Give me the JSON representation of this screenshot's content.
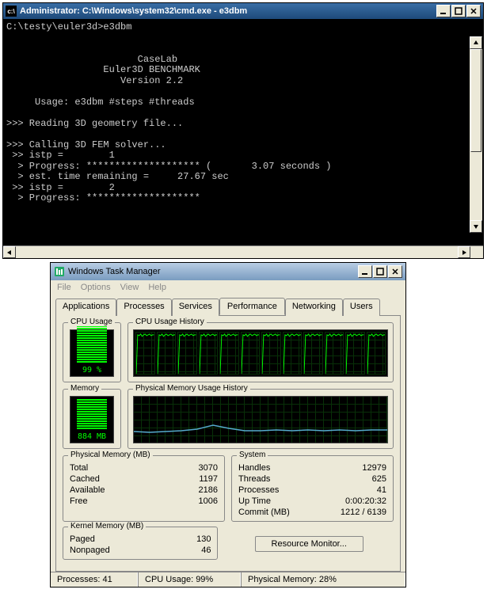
{
  "cmd": {
    "title": "Administrator: C:\\Windows\\system32\\cmd.exe - e3dbm",
    "content": "C:\\testy\\euler3d>e3dbm\n\n\n                       CaseLab\n                 Euler3D BENCHMARK\n                    Version 2.2\n\n     Usage: e3dbm #steps #threads\n\n>>> Reading 3D geometry file...\n\n>>> Calling 3D FEM solver...\n >> istp =        1\n  > Progress: ******************** (       3.07 seconds )\n  > est. time remaining =     27.67 sec\n >> istp =        2\n  > Progress: ********************"
  },
  "tm": {
    "title": "Windows Task Manager",
    "menu": {
      "file": "File",
      "options": "Options",
      "view": "View",
      "help": "Help"
    },
    "tabs": {
      "applications": "Applications",
      "processes": "Processes",
      "services": "Services",
      "performance": "Performance",
      "networking": "Networking",
      "users": "Users"
    },
    "cpu_usage_label": "CPU Usage",
    "cpu_usage_value": "99 %",
    "cpu_history_label": "CPU Usage History",
    "memory_label": "Memory",
    "memory_value": "884 MB",
    "mem_history_label": "Physical Memory Usage History",
    "phys_mem_label": "Physical Memory (MB)",
    "phys_mem": {
      "total_k": "Total",
      "total_v": "3070",
      "cached_k": "Cached",
      "cached_v": "1197",
      "available_k": "Available",
      "available_v": "2186",
      "free_k": "Free",
      "free_v": "1006"
    },
    "kernel_mem_label": "Kernel Memory (MB)",
    "kernel_mem": {
      "paged_k": "Paged",
      "paged_v": "130",
      "nonpaged_k": "Nonpaged",
      "nonpaged_v": "46"
    },
    "system_label": "System",
    "system": {
      "handles_k": "Handles",
      "handles_v": "12979",
      "threads_k": "Threads",
      "threads_v": "625",
      "processes_k": "Processes",
      "processes_v": "41",
      "uptime_k": "Up Time",
      "uptime_v": "0:00:20:32",
      "commit_k": "Commit (MB)",
      "commit_v": "1212 / 6139"
    },
    "resource_monitor": "Resource Monitor...",
    "status": {
      "processes": "Processes: 41",
      "cpu": "CPU Usage: 99%",
      "mem": "Physical Memory: 28%"
    }
  },
  "chart_data": [
    {
      "type": "bar",
      "title": "CPU Usage",
      "values": [
        99
      ],
      "ylim": [
        0,
        100
      ],
      "label": "99 %"
    },
    {
      "type": "line",
      "title": "CPU Usage History",
      "series_count": 12,
      "note": "12 logical CPU cores each near 100%",
      "ylim": [
        0,
        100
      ]
    },
    {
      "type": "bar",
      "title": "Memory",
      "values": [
        884
      ],
      "unit": "MB",
      "ylim": [
        0,
        3070
      ],
      "label": "884 MB"
    },
    {
      "type": "line",
      "title": "Physical Memory Usage History",
      "ylim": [
        0,
        3070
      ],
      "approx_values": [
        850,
        840,
        860,
        870,
        900,
        980,
        920,
        870,
        860,
        880,
        870,
        880,
        870,
        880,
        870,
        880,
        884
      ]
    }
  ]
}
